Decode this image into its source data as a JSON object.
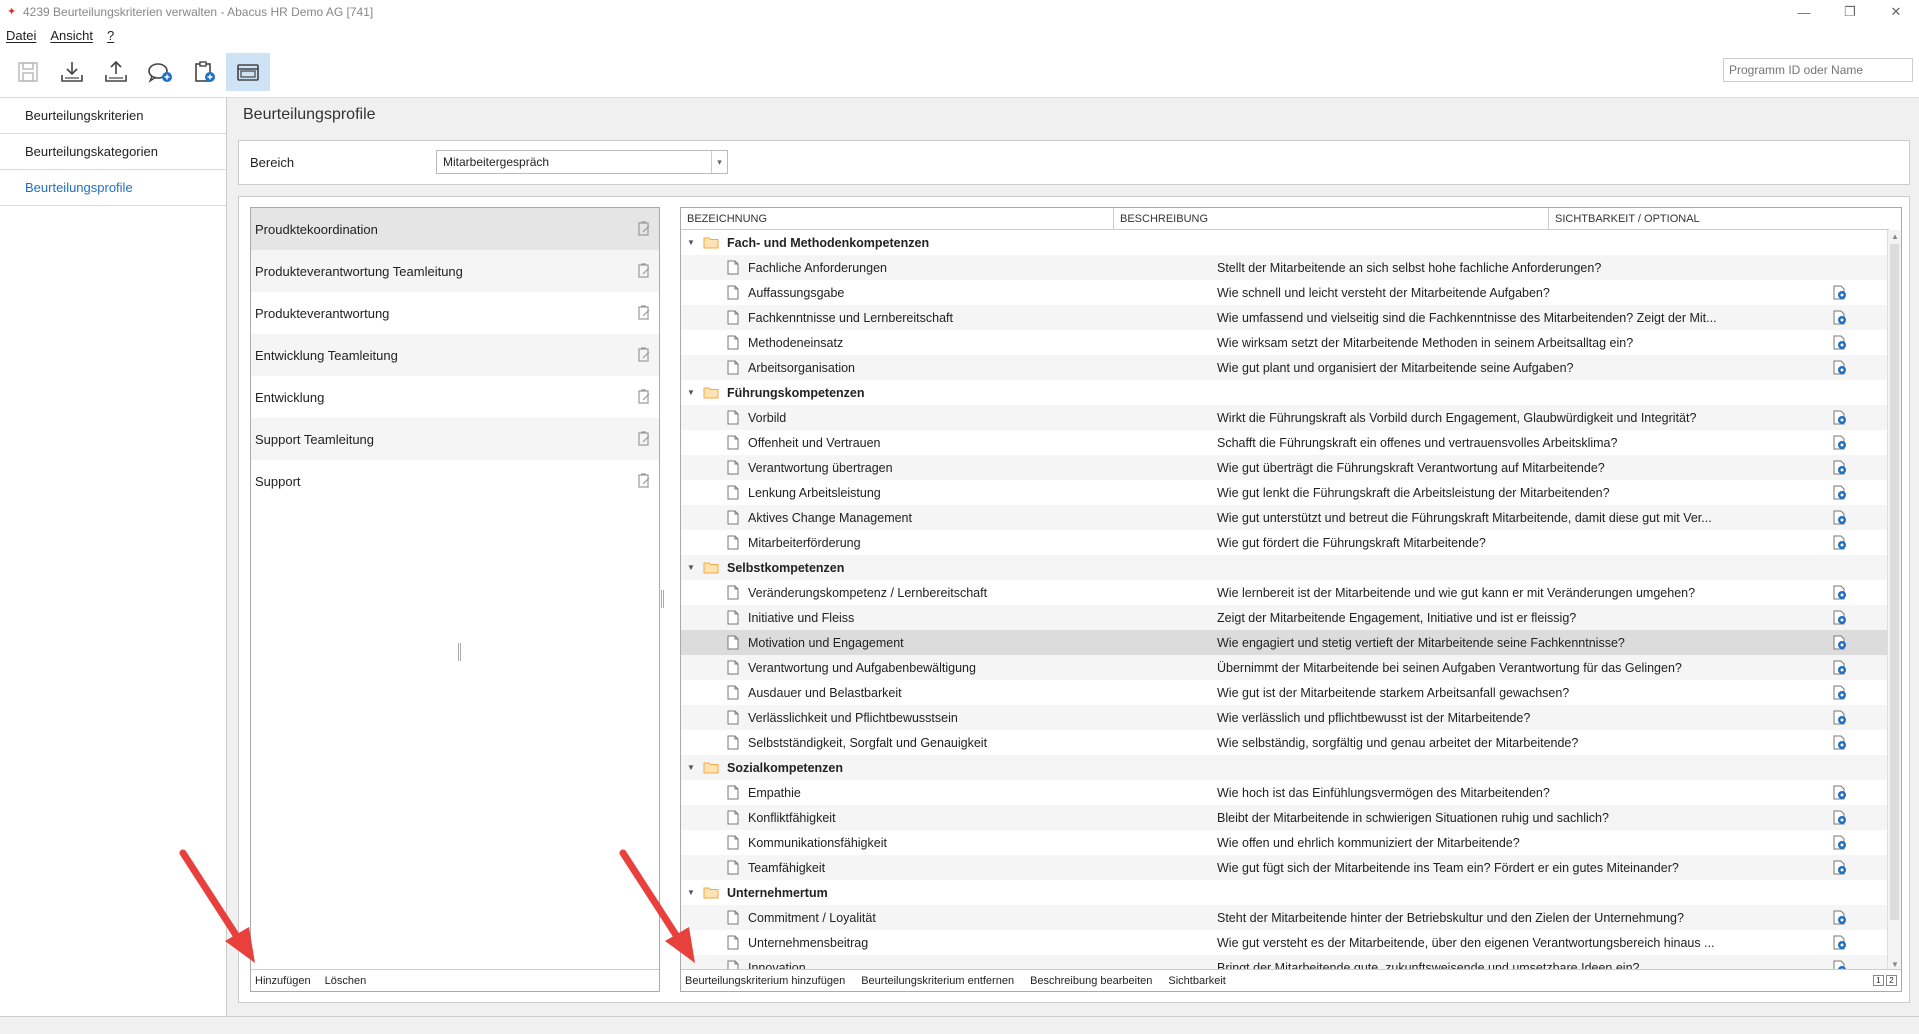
{
  "window": {
    "title": "4239 Beurteilungskriterien verwalten - Abacus HR Demo AG [741]"
  },
  "menu": [
    "Datei",
    "Ansicht",
    "?"
  ],
  "toolbar": {
    "search_placeholder": "Programm ID oder Name"
  },
  "nav": [
    {
      "label": "Beurteilungskriterien",
      "active": false
    },
    {
      "label": "Beurteilungskategorien",
      "active": false
    },
    {
      "label": "Beurteilungsprofile",
      "active": true
    }
  ],
  "page": {
    "title": "Beurteilungsprofile"
  },
  "bereich": {
    "label": "Bereich",
    "value": "Mitarbeitergespräch"
  },
  "profiles": [
    "Proudktekoordination",
    "Produkteverantwortung Teamleitung",
    "Produkteverantwortung",
    "Entwicklung Teamleitung",
    "Entwicklung",
    "Support Teamleitung",
    "Support"
  ],
  "profiles_footer": {
    "add": "Hinzufügen",
    "delete": "Löschen"
  },
  "grid": {
    "headers": {
      "name": "BEZEICHNUNG",
      "description": "BESCHREIBUNG",
      "visibility": "SICHTBARKEIT / OPTIONAL"
    },
    "rows": [
      {
        "type": "group",
        "name": "Fach- und Methodenkompetenzen",
        "desc": "",
        "vis": false
      },
      {
        "type": "item",
        "name": "Fachliche Anforderungen",
        "desc": "Stellt der Mitarbeitende an sich selbst hohe fachliche Anforderungen?",
        "vis": false
      },
      {
        "type": "item",
        "name": "Auffassungsgabe",
        "desc": "Wie schnell und leicht versteht der Mitarbeitende Aufgaben?",
        "vis": true
      },
      {
        "type": "item",
        "name": "Fachkenntnisse und Lernbereitschaft",
        "desc": "Wie umfassend und vielseitig sind die Fachkenntnisse des Mitarbeitenden? Zeigt der Mit...",
        "vis": true
      },
      {
        "type": "item",
        "name": "Methodeneinsatz",
        "desc": "Wie wirksam setzt der Mitarbeitende Methoden in seinem Arbeitsalltag ein?",
        "vis": true
      },
      {
        "type": "item",
        "name": "Arbeitsorganisation",
        "desc": "Wie gut plant und organisiert der Mitarbeitende seine Aufgaben?",
        "vis": true
      },
      {
        "type": "group",
        "name": "Führungskompetenzen",
        "desc": "",
        "vis": false
      },
      {
        "type": "item",
        "name": "Vorbild",
        "desc": "Wirkt die Führungskraft als Vorbild durch Engagement, Glaubwürdigkeit und Integrität?",
        "vis": true
      },
      {
        "type": "item",
        "name": "Offenheit und Vertrauen",
        "desc": "Schafft die Führungskraft ein offenes und vertrauensvolles Arbeitsklima?",
        "vis": true
      },
      {
        "type": "item",
        "name": "Verantwortung übertragen",
        "desc": "Wie gut überträgt die Führungskraft Verantwortung auf Mitarbeitende?",
        "vis": true
      },
      {
        "type": "item",
        "name": "Lenkung Arbeitsleistung",
        "desc": "Wie gut lenkt die Führungskraft die Arbeitsleistung der Mitarbeitenden?",
        "vis": true
      },
      {
        "type": "item",
        "name": "Aktives Change Management",
        "desc": "Wie gut unterstützt und betreut die Führungskraft Mitarbeitende, damit diese gut mit Ver...",
        "vis": true
      },
      {
        "type": "item",
        "name": "Mitarbeiterförderung",
        "desc": "Wie gut fördert die Führungskraft Mitarbeitende?",
        "vis": true
      },
      {
        "type": "group",
        "name": "Selbstkompetenzen",
        "desc": "",
        "vis": false
      },
      {
        "type": "item",
        "name": "Veränderungskompetenz / Lernbereitschaft",
        "desc": "Wie lernbereit ist der Mitarbeitende und wie gut kann er mit Veränderungen umgehen?",
        "vis": true
      },
      {
        "type": "item",
        "name": "Initiative und Fleiss",
        "desc": "Zeigt der Mitarbeitende Engagement, Initiative und ist er fleissig?",
        "vis": true
      },
      {
        "type": "item",
        "name": "Motivation und Engagement",
        "desc": "Wie engagiert und stetig vertieft der Mitarbeitende seine Fachkenntnisse?",
        "vis": true,
        "selected": true
      },
      {
        "type": "item",
        "name": "Verantwortung und Aufgabenbewältigung",
        "desc": "Übernimmt der Mitarbeitende bei seinen Aufgaben Verantwortung für das Gelingen?",
        "vis": true
      },
      {
        "type": "item",
        "name": "Ausdauer und Belastbarkeit",
        "desc": "Wie gut ist der Mitarbeitende starkem Arbeitsanfall gewachsen?",
        "vis": true
      },
      {
        "type": "item",
        "name": "Verlässlichkeit und Pflichtbewusstsein",
        "desc": "Wie verlässlich und pflichtbewusst ist der Mitarbeitende?",
        "vis": true
      },
      {
        "type": "item",
        "name": "Selbstständigkeit, Sorgfalt und Genauigkeit",
        "desc": "Wie selbständig, sorgfältig und genau arbeitet der Mitarbeitende?",
        "vis": true
      },
      {
        "type": "group",
        "name": "Sozialkompetenzen",
        "desc": "",
        "vis": false
      },
      {
        "type": "item",
        "name": "Empathie",
        "desc": "Wie hoch ist das Einfühlungsvermögen des Mitarbeitenden?",
        "vis": true
      },
      {
        "type": "item",
        "name": "Konfliktfähigkeit",
        "desc": "Bleibt der Mitarbeitende in schwierigen Situationen ruhig und sachlich?",
        "vis": true
      },
      {
        "type": "item",
        "name": "Kommunikationsfähigkeit",
        "desc": "Wie offen und ehrlich kommuniziert der Mitarbeitende?",
        "vis": true
      },
      {
        "type": "item",
        "name": "Teamfähigkeit",
        "desc": "Wie gut fügt sich der Mitarbeitende ins Team ein? Fördert er ein gutes Miteinander?",
        "vis": true
      },
      {
        "type": "group",
        "name": "Unternehmertum",
        "desc": "",
        "vis": false
      },
      {
        "type": "item",
        "name": "Commitment / Loyalität",
        "desc": "Steht der Mitarbeitende hinter der Betriebskultur und den Zielen der Unternehmung?",
        "vis": true
      },
      {
        "type": "item",
        "name": "Unternehmensbeitrag",
        "desc": "Wie gut versteht es der Mitarbeitende, über den eigenen Verantwortungsbereich hinaus ...",
        "vis": true
      },
      {
        "type": "item",
        "name": "Innovation",
        "desc": "Bringt der Mitarbeitende gute, zukunftsweisende und umsetzbare Ideen ein?",
        "vis": true
      }
    ]
  },
  "criteria_footer": {
    "add": "Beurteilungskriterium hinzufügen",
    "remove": "Beurteilungskriterium entfernen",
    "edit": "Beschreibung bearbeiten",
    "visibility": "Sichtbarkeit",
    "page1": "1",
    "page2": "2"
  },
  "colors": {
    "accent": "#1f6fc5",
    "folder": "#f3a942",
    "arrow": "#e8403c"
  }
}
